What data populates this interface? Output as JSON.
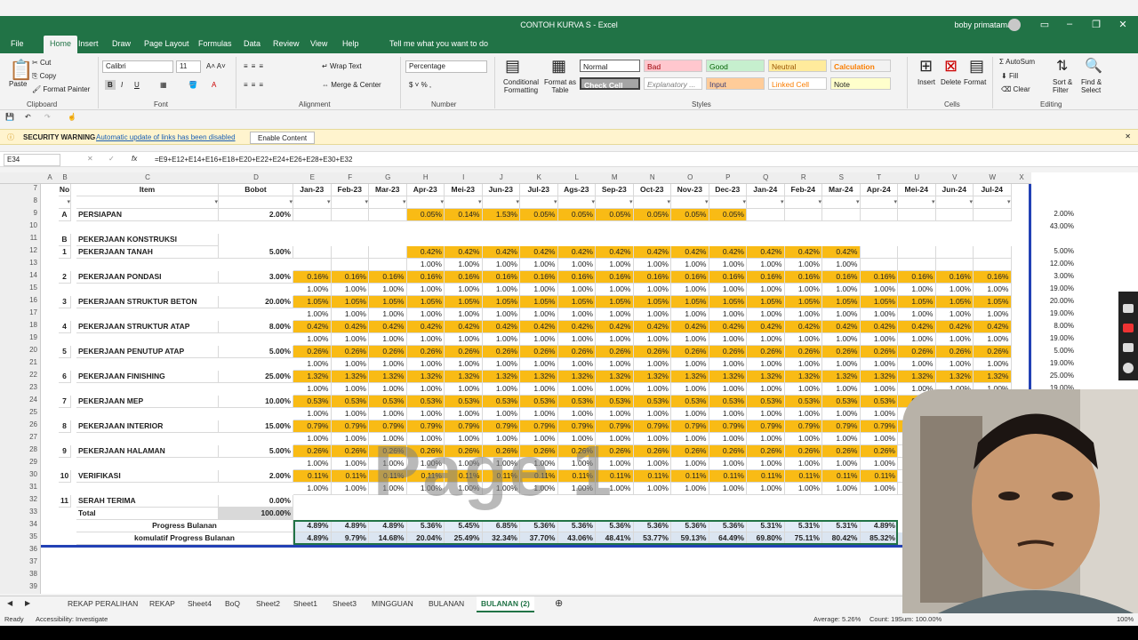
{
  "window": {
    "title": "CONTOH KURVA S - Excel",
    "user": "boby primatama"
  },
  "tabs": [
    "File",
    "Home",
    "Insert",
    "Draw",
    "Page Layout",
    "Formulas",
    "Data",
    "Review",
    "View",
    "Help",
    "Tell me what you want to do"
  ],
  "ribbon": {
    "clipboard": {
      "paste": "Paste",
      "cut": "Cut",
      "copy": "Copy",
      "painter": "Format Painter",
      "label": "Clipboard"
    },
    "font": {
      "name": "Calibri",
      "size": "11",
      "label": "Font"
    },
    "alignment": {
      "wrap": "Wrap Text",
      "merge": "Merge & Center",
      "label": "Alignment"
    },
    "number": {
      "format": "Percentage",
      "label": "Number"
    },
    "styles": {
      "cond": "Conditional Formatting",
      "table": "Format as Table",
      "normal": "Normal",
      "bad": "Bad",
      "good": "Good",
      "neutral": "Neutral",
      "calc": "Calculation",
      "check": "Check Cell",
      "expl": "Explanatory ...",
      "input": "Input",
      "linked": "Linked Cell",
      "note": "Note",
      "label": "Styles"
    },
    "cells": {
      "insert": "Insert",
      "delete": "Delete",
      "format": "Format",
      "label": "Cells"
    },
    "editing": {
      "autosum": "AutoSum",
      "fill": "Fill",
      "clear": "Clear",
      "sort": "Sort & Filter",
      "find": "Find & Select",
      "label": "Editing"
    }
  },
  "warning": {
    "title": "SECURITY WARNING",
    "message": "Automatic update of links has been disabled",
    "button": "Enable Content"
  },
  "namebox": "E34",
  "formula": "=E9+E12+E14+E16+E18+E20+E22+E24+E26+E28+E30+E32",
  "columns": [
    "A",
    "B",
    "C",
    "D",
    "E",
    "F",
    "G",
    "H",
    "I",
    "J",
    "K",
    "L",
    "M",
    "N",
    "O",
    "P",
    "Q",
    "R",
    "S",
    "T",
    "U",
    "V",
    "W",
    "X",
    "Y",
    "Z"
  ],
  "header": {
    "no": "No",
    "item": "Item",
    "bobot": "Bobot",
    "months": [
      "Jan-23",
      "Feb-23",
      "Mar-23",
      "Apr-23",
      "Mei-23",
      "Jun-23",
      "Jul-23",
      "Ags-23",
      "Sep-23",
      "Oct-23",
      "Nov-23",
      "Dec-23",
      "Jan-24",
      "Feb-24",
      "Mar-24",
      "Apr-24",
      "Mei-24",
      "Jun-24",
      "Jul-24"
    ]
  },
  "rows": [
    {
      "r": "9",
      "b": "A",
      "c": "PERSIAPAN",
      "d": "2.00%",
      "vals": [
        "",
        "",
        "",
        "0.05%",
        "0.14%",
        "1.53%",
        "0.05%",
        "0.05%",
        "0.05%",
        "0.05%",
        "0.05%",
        "0.05%",
        "",
        "",
        "",
        "",
        "",
        "",
        ""
      ],
      "y": "2.00%"
    },
    {
      "r": "10",
      "vals": [],
      "y": "43.00%"
    },
    {
      "r": "11",
      "b": "B",
      "c": "PEKERJAAN KONSTRUKSI",
      "vals": []
    },
    {
      "r": "12",
      "b": "1",
      "c": "PEKERJAAN TANAH",
      "d": "5.00%",
      "vals": [
        "",
        "",
        "",
        "0.42%",
        "0.42%",
        "0.42%",
        "0.42%",
        "0.42%",
        "0.42%",
        "0.42%",
        "0.42%",
        "0.42%",
        "0.42%",
        "0.42%",
        "0.42%",
        "",
        "",
        "",
        ""
      ],
      "y": "5.00%"
    },
    {
      "r": "13",
      "vals": [
        "",
        "",
        "",
        "1.00%",
        "1.00%",
        "1.00%",
        "1.00%",
        "1.00%",
        "1.00%",
        "1.00%",
        "1.00%",
        "1.00%",
        "1.00%",
        "1.00%",
        "1.00%",
        "",
        "",
        "",
        ""
      ],
      "y": "12.00%"
    },
    {
      "r": "14",
      "b": "2",
      "c": "PEKERJAAN PONDASI",
      "d": "3.00%",
      "vals": [
        "0.16%",
        "0.16%",
        "0.16%",
        "0.16%",
        "0.16%",
        "0.16%",
        "0.16%",
        "0.16%",
        "0.16%",
        "0.16%",
        "0.16%",
        "0.16%",
        "0.16%",
        "0.16%",
        "0.16%",
        "0.16%",
        "0.16%",
        "0.16%",
        "0.16%"
      ],
      "y": "3.00%"
    },
    {
      "r": "15",
      "vals": [
        "1.00%",
        "1.00%",
        "1.00%",
        "1.00%",
        "1.00%",
        "1.00%",
        "1.00%",
        "1.00%",
        "1.00%",
        "1.00%",
        "1.00%",
        "1.00%",
        "1.00%",
        "1.00%",
        "1.00%",
        "1.00%",
        "1.00%",
        "1.00%",
        "1.00%"
      ],
      "y": "19.00%"
    },
    {
      "r": "16",
      "b": "3",
      "c": "PEKERJAAN STRUKTUR BETON",
      "d": "20.00%",
      "vals": [
        "1.05%",
        "1.05%",
        "1.05%",
        "1.05%",
        "1.05%",
        "1.05%",
        "1.05%",
        "1.05%",
        "1.05%",
        "1.05%",
        "1.05%",
        "1.05%",
        "1.05%",
        "1.05%",
        "1.05%",
        "1.05%",
        "1.05%",
        "1.05%",
        "1.05%"
      ],
      "y": "20.00%"
    },
    {
      "r": "17",
      "vals": [
        "1.00%",
        "1.00%",
        "1.00%",
        "1.00%",
        "1.00%",
        "1.00%",
        "1.00%",
        "1.00%",
        "1.00%",
        "1.00%",
        "1.00%",
        "1.00%",
        "1.00%",
        "1.00%",
        "1.00%",
        "1.00%",
        "1.00%",
        "1.00%",
        "1.00%"
      ],
      "y": "19.00%"
    },
    {
      "r": "18",
      "b": "4",
      "c": "PEKERJAAN STRUKTUR ATAP",
      "d": "8.00%",
      "vals": [
        "0.42%",
        "0.42%",
        "0.42%",
        "0.42%",
        "0.42%",
        "0.42%",
        "0.42%",
        "0.42%",
        "0.42%",
        "0.42%",
        "0.42%",
        "0.42%",
        "0.42%",
        "0.42%",
        "0.42%",
        "0.42%",
        "0.42%",
        "0.42%",
        "0.42%"
      ],
      "y": "8.00%"
    },
    {
      "r": "19",
      "vals": [
        "1.00%",
        "1.00%",
        "1.00%",
        "1.00%",
        "1.00%",
        "1.00%",
        "1.00%",
        "1.00%",
        "1.00%",
        "1.00%",
        "1.00%",
        "1.00%",
        "1.00%",
        "1.00%",
        "1.00%",
        "1.00%",
        "1.00%",
        "1.00%",
        "1.00%"
      ],
      "y": "19.00%"
    },
    {
      "r": "20",
      "b": "5",
      "c": "PEKERJAAN PENUTUP ATAP",
      "d": "5.00%",
      "vals": [
        "0.26%",
        "0.26%",
        "0.26%",
        "0.26%",
        "0.26%",
        "0.26%",
        "0.26%",
        "0.26%",
        "0.26%",
        "0.26%",
        "0.26%",
        "0.26%",
        "0.26%",
        "0.26%",
        "0.26%",
        "0.26%",
        "0.26%",
        "0.26%",
        "0.26%"
      ],
      "y": "5.00%"
    },
    {
      "r": "21",
      "vals": [
        "1.00%",
        "1.00%",
        "1.00%",
        "1.00%",
        "1.00%",
        "1.00%",
        "1.00%",
        "1.00%",
        "1.00%",
        "1.00%",
        "1.00%",
        "1.00%",
        "1.00%",
        "1.00%",
        "1.00%",
        "1.00%",
        "1.00%",
        "1.00%",
        "1.00%"
      ],
      "y": "19.00%"
    },
    {
      "r": "22",
      "b": "6",
      "c": "PEKERJAAN FINISHING",
      "d": "25.00%",
      "vals": [
        "1.32%",
        "1.32%",
        "1.32%",
        "1.32%",
        "1.32%",
        "1.32%",
        "1.32%",
        "1.32%",
        "1.32%",
        "1.32%",
        "1.32%",
        "1.32%",
        "1.32%",
        "1.32%",
        "1.32%",
        "1.32%",
        "1.32%",
        "1.32%",
        "1.32%"
      ],
      "y": "25.00%"
    },
    {
      "r": "23",
      "vals": [
        "1.00%",
        "1.00%",
        "1.00%",
        "1.00%",
        "1.00%",
        "1.00%",
        "1.00%",
        "1.00%",
        "1.00%",
        "1.00%",
        "1.00%",
        "1.00%",
        "1.00%",
        "1.00%",
        "1.00%",
        "1.00%",
        "1.00%",
        "1.00%",
        "1.00%"
      ],
      "y": "19.00%"
    },
    {
      "r": "24",
      "b": "7",
      "c": "PEKERJAAN MEP",
      "d": "10.00%",
      "vals": [
        "0.53%",
        "0.53%",
        "0.53%",
        "0.53%",
        "0.53%",
        "0.53%",
        "0.53%",
        "0.53%",
        "0.53%",
        "0.53%",
        "0.53%",
        "0.53%",
        "0.53%",
        "0.53%",
        "0.53%",
        "0.53%",
        "0.53%",
        "0.53%",
        ""
      ]
    },
    {
      "r": "25",
      "vals": [
        "1.00%",
        "1.00%",
        "1.00%",
        "1.00%",
        "1.00%",
        "1.00%",
        "1.00%",
        "1.00%",
        "1.00%",
        "1.00%",
        "1.00%",
        "1.00%",
        "1.00%",
        "1.00%",
        "1.00%",
        "1.00%",
        "1.00%",
        "",
        ""
      ]
    },
    {
      "r": "26",
      "b": "8",
      "c": "PEKERJAAN INTERIOR",
      "d": "15.00%",
      "vals": [
        "0.79%",
        "0.79%",
        "0.79%",
        "0.79%",
        "0.79%",
        "0.79%",
        "0.79%",
        "0.79%",
        "0.79%",
        "0.79%",
        "0.79%",
        "0.79%",
        "0.79%",
        "0.79%",
        "0.79%",
        "0.79%",
        "0.79%",
        "",
        ""
      ]
    },
    {
      "r": "27",
      "vals": [
        "1.00%",
        "1.00%",
        "1.00%",
        "1.00%",
        "1.00%",
        "1.00%",
        "1.00%",
        "1.00%",
        "1.00%",
        "1.00%",
        "1.00%",
        "1.00%",
        "1.00%",
        "1.00%",
        "1.00%",
        "1.00%",
        "1.00%",
        "",
        ""
      ]
    },
    {
      "r": "28",
      "b": "9",
      "c": "PEKERJAAN HALAMAN",
      "d": "5.00%",
      "vals": [
        "0.26%",
        "0.26%",
        "0.26%",
        "0.26%",
        "0.26%",
        "0.26%",
        "0.26%",
        "0.26%",
        "0.26%",
        "0.26%",
        "0.26%",
        "0.26%",
        "0.26%",
        "0.26%",
        "0.26%",
        "0.26%",
        "",
        "",
        ""
      ]
    },
    {
      "r": "29",
      "vals": [
        "1.00%",
        "1.00%",
        "1.00%",
        "1.00%",
        "1.00%",
        "1.00%",
        "1.00%",
        "1.00%",
        "1.00%",
        "1.00%",
        "1.00%",
        "1.00%",
        "1.00%",
        "1.00%",
        "1.00%",
        "1.00%",
        "",
        "",
        ""
      ]
    },
    {
      "r": "30",
      "b": "10",
      "c": "VERIFIKASI",
      "d": "2.00%",
      "vals": [
        "0.11%",
        "0.11%",
        "0.11%",
        "0.11%",
        "0.11%",
        "0.11%",
        "0.11%",
        "0.11%",
        "0.11%",
        "0.11%",
        "0.11%",
        "0.11%",
        "0.11%",
        "0.11%",
        "0.11%",
        "0.11%",
        "",
        "",
        ""
      ]
    },
    {
      "r": "31",
      "vals": [
        "1.00%",
        "1.00%",
        "1.00%",
        "1.00%",
        "1.00%",
        "1.00%",
        "1.00%",
        "1.00%",
        "1.00%",
        "1.00%",
        "1.00%",
        "1.00%",
        "1.00%",
        "1.00%",
        "1.00%",
        "1.00%",
        "",
        "",
        ""
      ]
    },
    {
      "r": "32",
      "b": "11",
      "c": "SERAH TERIMA",
      "d": "0.00%",
      "vals": []
    },
    {
      "r": "33",
      "c": "Total",
      "d": "100.00%",
      "vals": []
    },
    {
      "r": "34",
      "c": "Progress Bulanan",
      "vals": [
        "4.89%",
        "4.89%",
        "4.89%",
        "5.36%",
        "5.45%",
        "6.85%",
        "5.36%",
        "5.36%",
        "5.36%",
        "5.36%",
        "5.36%",
        "5.36%",
        "5.31%",
        "5.31%",
        "5.31%",
        "4.89%",
        "",
        "",
        ""
      ]
    },
    {
      "r": "35",
      "c": "komulatif Progress Bulanan",
      "vals": [
        "4.89%",
        "9.79%",
        "14.68%",
        "20.04%",
        "25.49%",
        "32.34%",
        "37.70%",
        "43.06%",
        "48.41%",
        "53.77%",
        "59.13%",
        "64.49%",
        "69.80%",
        "75.11%",
        "80.42%",
        "85.32%",
        "",
        "",
        ""
      ]
    },
    {
      "r": "36",
      "vals": []
    },
    {
      "r": "37",
      "vals": []
    },
    {
      "r": "38",
      "vals": []
    },
    {
      "r": "39",
      "vals": []
    }
  ],
  "watermark": "Page 1",
  "sheets": [
    "REKAP PERALIHAN",
    "REKAP",
    "Sheet4",
    "BoQ",
    "Sheet2",
    "Sheet1",
    "Sheet3",
    "MINGGUAN",
    "BULANAN",
    "BULANAN (2)"
  ],
  "status": {
    "ready": "Ready",
    "access": "Accessibility: Investigate",
    "avg": "Average: 5.26%",
    "count": "Count: 19",
    "sum": "Sum: 100.00%",
    "zoom": "100%"
  }
}
